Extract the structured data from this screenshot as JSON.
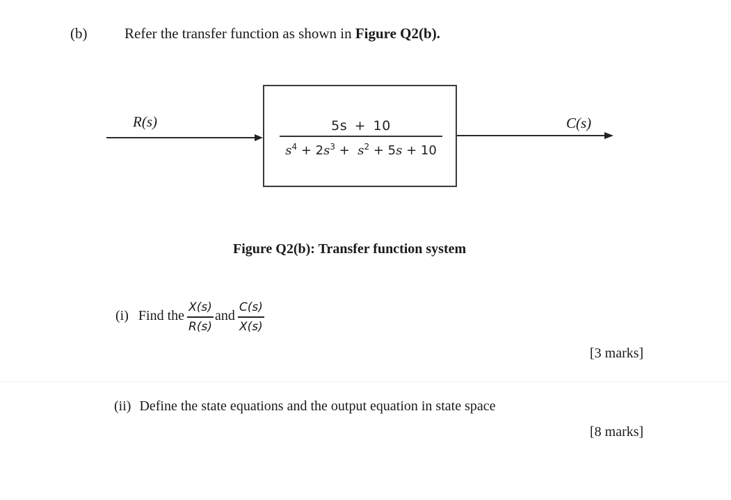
{
  "question": {
    "part_label": "(b)",
    "intro_text": "Refer the transfer function as shown in ",
    "intro_ref": "Figure Q2(b)."
  },
  "figure": {
    "input_signal": "R(s)",
    "output_signal": "C(s)",
    "transfer_function": {
      "numerator": "5s + 10",
      "denominator_terms": [
        {
          "base": "s",
          "coef": "",
          "exp": "4"
        },
        {
          "op": " + "
        },
        {
          "coef": "2",
          "base": "s",
          "exp": "3"
        },
        {
          "op": " +  "
        },
        {
          "base": "s",
          "coef": "",
          "exp": "2"
        },
        {
          "op": " + "
        },
        {
          "coef": "5",
          "base": "s",
          "exp": ""
        },
        {
          "op": " + "
        },
        {
          "const": "10"
        }
      ],
      "denominator_text": "s⁴ + 2s³ + s² + 5s + 10"
    },
    "caption": "Figure Q2(b): Transfer function system",
    "colors": {
      "ink": "#1a1a1a",
      "box_border": "#3a3a3a"
    }
  },
  "sub_questions": [
    {
      "label": "(i)",
      "text_before": "Find  the",
      "fraction1": {
        "numerator": "X(s)",
        "denominator": "R(s)"
      },
      "text_between": "and",
      "fraction2": {
        "numerator": "C(s)",
        "denominator": "X(s)"
      },
      "marks": "[3 marks]"
    },
    {
      "label": "(ii)",
      "text": "Define the state equations and the output equation in state space",
      "marks": "[8 marks]"
    }
  ]
}
